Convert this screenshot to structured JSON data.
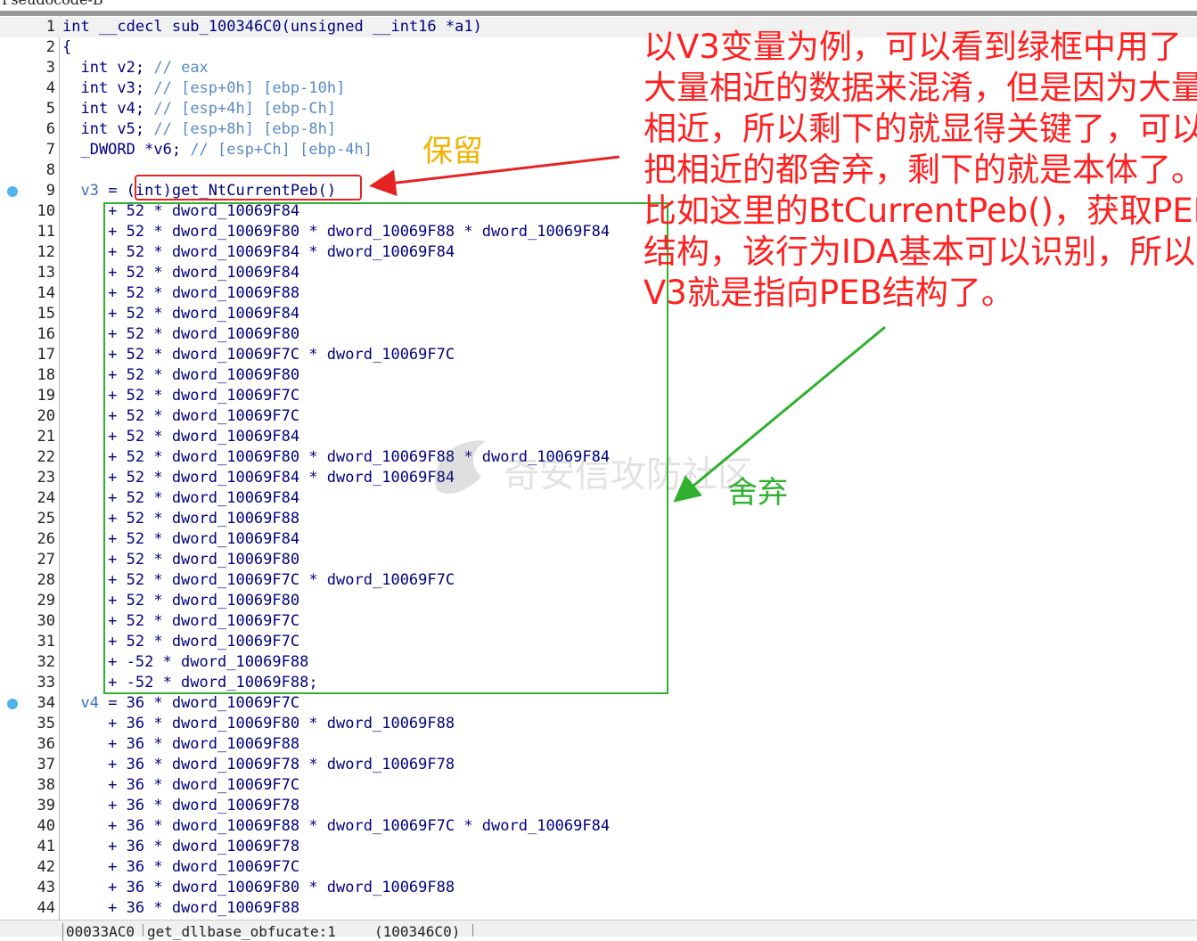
{
  "window": {
    "title": "Pseudocode-B"
  },
  "code_lines": [
    {
      "n": "1",
      "bp": false,
      "hl": true,
      "segs": [
        [
          "kw",
          "int"
        ],
        [
          "plain",
          " __cdecl sub_100346C0(unsigned __int16 *a1)"
        ]
      ]
    },
    {
      "n": "2",
      "bp": false,
      "hl": false,
      "segs": [
        [
          "plain",
          "{"
        ]
      ]
    },
    {
      "n": "3",
      "bp": false,
      "hl": false,
      "segs": [
        [
          "kw",
          "  int"
        ],
        [
          "plain",
          " v2; "
        ],
        [
          "cmt",
          "// eax"
        ]
      ]
    },
    {
      "n": "4",
      "bp": false,
      "hl": false,
      "segs": [
        [
          "kw",
          "  int"
        ],
        [
          "plain",
          " v3; "
        ],
        [
          "cmt",
          "// [esp+0h] [ebp-10h]"
        ]
      ]
    },
    {
      "n": "5",
      "bp": false,
      "hl": false,
      "segs": [
        [
          "kw",
          "  int"
        ],
        [
          "plain",
          " v4; "
        ],
        [
          "cmt",
          "// [esp+4h] [ebp-Ch]"
        ]
      ]
    },
    {
      "n": "6",
      "bp": false,
      "hl": false,
      "segs": [
        [
          "kw",
          "  int"
        ],
        [
          "plain",
          " v5; "
        ],
        [
          "cmt",
          "// [esp+8h] [ebp-8h]"
        ]
      ]
    },
    {
      "n": "7",
      "bp": false,
      "hl": false,
      "segs": [
        [
          "kw",
          "  _DWORD"
        ],
        [
          "plain",
          " *v6; "
        ],
        [
          "cmt",
          "// [esp+Ch] [ebp-4h]"
        ]
      ]
    },
    {
      "n": "8",
      "bp": false,
      "hl": false,
      "segs": [
        [
          "plain",
          ""
        ]
      ]
    },
    {
      "n": "9",
      "bp": true,
      "hl": false,
      "segs": [
        [
          "var",
          "  v3"
        ],
        [
          "plain",
          " = (int)get_NtCurrentPeb()"
        ]
      ]
    },
    {
      "n": "10",
      "bp": false,
      "hl": false,
      "segs": [
        [
          "plain",
          "     + 52 * dword_10069F84"
        ]
      ]
    },
    {
      "n": "11",
      "bp": false,
      "hl": false,
      "segs": [
        [
          "plain",
          "     + 52 * dword_10069F80 * dword_10069F88 * dword_10069F84"
        ]
      ]
    },
    {
      "n": "12",
      "bp": false,
      "hl": false,
      "segs": [
        [
          "plain",
          "     + 52 * dword_10069F84 * dword_10069F84"
        ]
      ]
    },
    {
      "n": "13",
      "bp": false,
      "hl": false,
      "segs": [
        [
          "plain",
          "     + 52 * dword_10069F84"
        ]
      ]
    },
    {
      "n": "14",
      "bp": false,
      "hl": false,
      "segs": [
        [
          "plain",
          "     + 52 * dword_10069F88"
        ]
      ]
    },
    {
      "n": "15",
      "bp": false,
      "hl": false,
      "segs": [
        [
          "plain",
          "     + 52 * dword_10069F84"
        ]
      ]
    },
    {
      "n": "16",
      "bp": false,
      "hl": false,
      "segs": [
        [
          "plain",
          "     + 52 * dword_10069F80"
        ]
      ]
    },
    {
      "n": "17",
      "bp": false,
      "hl": false,
      "segs": [
        [
          "plain",
          "     + 52 * dword_10069F7C * dword_10069F7C"
        ]
      ]
    },
    {
      "n": "18",
      "bp": false,
      "hl": false,
      "segs": [
        [
          "plain",
          "     + 52 * dword_10069F80"
        ]
      ]
    },
    {
      "n": "19",
      "bp": false,
      "hl": false,
      "segs": [
        [
          "plain",
          "     + 52 * dword_10069F7C"
        ]
      ]
    },
    {
      "n": "20",
      "bp": false,
      "hl": false,
      "segs": [
        [
          "plain",
          "     + 52 * dword_10069F7C"
        ]
      ]
    },
    {
      "n": "21",
      "bp": false,
      "hl": false,
      "segs": [
        [
          "plain",
          "     + 52 * dword_10069F84"
        ]
      ]
    },
    {
      "n": "22",
      "bp": false,
      "hl": false,
      "segs": [
        [
          "plain",
          "     + 52 * dword_10069F80 * dword_10069F88 * dword_10069F84"
        ]
      ]
    },
    {
      "n": "23",
      "bp": false,
      "hl": false,
      "segs": [
        [
          "plain",
          "     + 52 * dword_10069F84 * dword_10069F84"
        ]
      ]
    },
    {
      "n": "24",
      "bp": false,
      "hl": false,
      "segs": [
        [
          "plain",
          "     + 52 * dword_10069F84"
        ]
      ]
    },
    {
      "n": "25",
      "bp": false,
      "hl": false,
      "segs": [
        [
          "plain",
          "     + 52 * dword_10069F88"
        ]
      ]
    },
    {
      "n": "26",
      "bp": false,
      "hl": false,
      "segs": [
        [
          "plain",
          "     + 52 * dword_10069F84"
        ]
      ]
    },
    {
      "n": "27",
      "bp": false,
      "hl": false,
      "segs": [
        [
          "plain",
          "     + 52 * dword_10069F80"
        ]
      ]
    },
    {
      "n": "28",
      "bp": false,
      "hl": false,
      "segs": [
        [
          "plain",
          "     + 52 * dword_10069F7C * dword_10069F7C"
        ]
      ]
    },
    {
      "n": "29",
      "bp": false,
      "hl": false,
      "segs": [
        [
          "plain",
          "     + 52 * dword_10069F80"
        ]
      ]
    },
    {
      "n": "30",
      "bp": false,
      "hl": false,
      "segs": [
        [
          "plain",
          "     + 52 * dword_10069F7C"
        ]
      ]
    },
    {
      "n": "31",
      "bp": false,
      "hl": false,
      "segs": [
        [
          "plain",
          "     + 52 * dword_10069F7C"
        ]
      ]
    },
    {
      "n": "32",
      "bp": false,
      "hl": false,
      "segs": [
        [
          "plain",
          "     + -52 * dword_10069F88"
        ]
      ]
    },
    {
      "n": "33",
      "bp": false,
      "hl": false,
      "segs": [
        [
          "plain",
          "     + -52 * dword_10069F88;"
        ]
      ]
    },
    {
      "n": "34",
      "bp": true,
      "hl": false,
      "segs": [
        [
          "var",
          "  v4"
        ],
        [
          "plain",
          " = 36 * dword_10069F7C"
        ]
      ]
    },
    {
      "n": "35",
      "bp": false,
      "hl": false,
      "segs": [
        [
          "plain",
          "     + 36 * dword_10069F80 * dword_10069F88"
        ]
      ]
    },
    {
      "n": "36",
      "bp": false,
      "hl": false,
      "segs": [
        [
          "plain",
          "     + 36 * dword_10069F88"
        ]
      ]
    },
    {
      "n": "37",
      "bp": false,
      "hl": false,
      "segs": [
        [
          "plain",
          "     + 36 * dword_10069F78 * dword_10069F78"
        ]
      ]
    },
    {
      "n": "38",
      "bp": false,
      "hl": false,
      "segs": [
        [
          "plain",
          "     + 36 * dword_10069F7C"
        ]
      ]
    },
    {
      "n": "39",
      "bp": false,
      "hl": false,
      "segs": [
        [
          "plain",
          "     + 36 * dword_10069F78"
        ]
      ]
    },
    {
      "n": "40",
      "bp": false,
      "hl": false,
      "segs": [
        [
          "plain",
          "     + 36 * dword_10069F88 * dword_10069F7C * dword_10069F84"
        ]
      ]
    },
    {
      "n": "41",
      "bp": false,
      "hl": false,
      "segs": [
        [
          "plain",
          "     + 36 * dword_10069F78"
        ]
      ]
    },
    {
      "n": "42",
      "bp": false,
      "hl": false,
      "segs": [
        [
          "plain",
          "     + 36 * dword_10069F7C"
        ]
      ]
    },
    {
      "n": "43",
      "bp": false,
      "hl": false,
      "segs": [
        [
          "plain",
          "     + 36 * dword_10069F80 * dword_10069F88"
        ]
      ]
    },
    {
      "n": "44",
      "bp": false,
      "hl": false,
      "segs": [
        [
          "plain",
          "     + 36 * dword_10069F88"
        ]
      ]
    }
  ],
  "annotations": {
    "keep_label": "保留",
    "discard_label": "舍弃",
    "note_lines": [
      "以V3变量为例，可以看到绿框中用了",
      "大量相近的数据来混淆，但是因为大量",
      "相近，所以剩下的就显得关键了，可以",
      "把相近的都舍弃，剩下的就是本体了。",
      "比如这里的BtCurrentPeb()，获取PEB",
      "结构，该行为IDA基本可以识别，所以",
      "V3就是指向PEB结构了。"
    ],
    "watermark": "奇安信攻防社区"
  },
  "statusbar": {
    "address": "00033AC0",
    "function": "get_dllbase_obfucate:1",
    "ea": "(100346C0)"
  },
  "colors": {
    "keep_box": "#e52323",
    "discard_box": "#2fb02f",
    "keep_text": "#f2b300",
    "note_text": "#ff2020",
    "breakpoint": "#4fb3ee"
  }
}
